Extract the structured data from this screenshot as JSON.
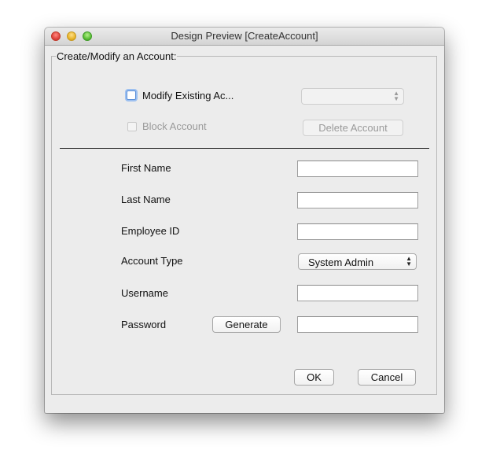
{
  "window": {
    "title": "Design Preview [CreateAccount]"
  },
  "group": {
    "title": "Create/Modify an Account:"
  },
  "modify_existing": {
    "label": "Modify Existing Ac...",
    "checked": false,
    "selector_value": ""
  },
  "block_account": {
    "label": "Block Account",
    "checked": false,
    "enabled": false
  },
  "delete_account_label": "Delete Account",
  "fields": {
    "first_name": {
      "label": "First Name",
      "value": ""
    },
    "last_name": {
      "label": "Last Name",
      "value": ""
    },
    "employee_id": {
      "label": "Employee ID",
      "value": ""
    },
    "account_type": {
      "label": "Account Type",
      "selected": "System Admin"
    },
    "username": {
      "label": "Username",
      "value": ""
    },
    "password": {
      "label": "Password",
      "value": "",
      "generate_label": "Generate"
    }
  },
  "buttons": {
    "ok": "OK",
    "cancel": "Cancel"
  }
}
